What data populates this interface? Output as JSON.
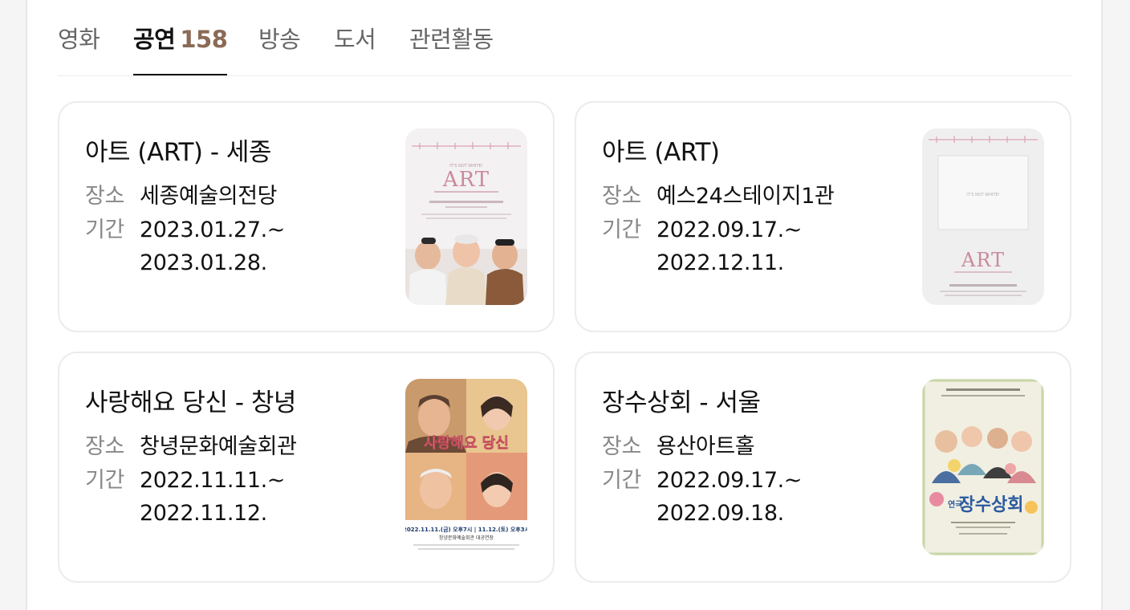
{
  "tabs": [
    {
      "label": "영화",
      "count": ""
    },
    {
      "label": "공연",
      "count": "158",
      "active": true
    },
    {
      "label": "방송",
      "count": ""
    },
    {
      "label": "도서",
      "count": ""
    },
    {
      "label": "관련활동",
      "count": ""
    }
  ],
  "field_labels": {
    "venue": "장소",
    "period": "기간"
  },
  "cards": [
    {
      "title": "아트 (ART) - 세종",
      "venue": "세종예술의전당",
      "period_start": "2023.01.27.~",
      "period_end": "2023.01.28.",
      "poster": {
        "headline": "ART",
        "tagline": "IT'S NOT WHITE!"
      }
    },
    {
      "title": "아트 (ART)",
      "venue": "예스24스테이지1관",
      "period_start": "2022.09.17.~",
      "period_end": "2022.12.11.",
      "poster": {
        "headline": "ART",
        "tagline": "IT'S NOT WHITE!"
      }
    },
    {
      "title": "사랑해요 당신 - 창녕",
      "venue": "창녕문화예술회관",
      "period_start": "2022.11.11.~",
      "period_end": "2022.11.12.",
      "poster": {
        "headline": "사랑해요 당신",
        "dates": "2022.11.11.(금) 오후7시 | 11.12.(토) 오후3시",
        "hall": "창녕문화예술회관 대공연장"
      }
    },
    {
      "title": "장수상회 - 서울",
      "venue": "용산아트홀",
      "period_start": "2022.09.17.~",
      "period_end": "2022.09.18.",
      "poster": {
        "headline": "장수상회",
        "prefix": "연극"
      }
    }
  ],
  "colors": {
    "accent_count": "#8a6a55",
    "label_gray": "#888888",
    "border": "#ececec"
  }
}
